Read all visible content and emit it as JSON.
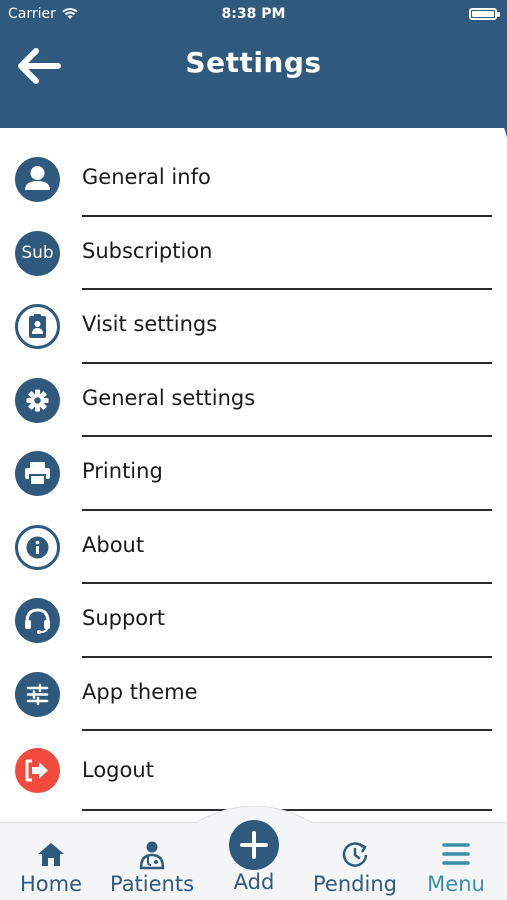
{
  "status_bar": {
    "carrier": "Carrier",
    "time": "8:38 PM"
  },
  "header": {
    "title": "Settings",
    "color": "#2f5a7e"
  },
  "menu": {
    "items": [
      {
        "label": "General info",
        "icon": "person-icon"
      },
      {
        "label": "Subscription",
        "icon": "sub-icon",
        "icon_text": "Sub"
      },
      {
        "label": "Visit settings",
        "icon": "clipboard-icon"
      },
      {
        "label": "General settings",
        "icon": "gear-icon"
      },
      {
        "label": "Printing",
        "icon": "printer-icon"
      },
      {
        "label": "About",
        "icon": "info-icon"
      },
      {
        "label": "Support",
        "icon": "headset-icon"
      },
      {
        "label": "App theme",
        "icon": "sliders-icon"
      },
      {
        "label": "Logout",
        "icon": "logout-icon",
        "accent": "#f24a3d"
      }
    ]
  },
  "bottom_nav": {
    "items": [
      {
        "label": "Home",
        "icon": "home-icon"
      },
      {
        "label": "Patients",
        "icon": "doctor-icon"
      },
      {
        "label": "Add",
        "icon": "plus-icon"
      },
      {
        "label": "Pending",
        "icon": "clock-refresh-icon"
      },
      {
        "label": "Menu",
        "icon": "hamburger-icon",
        "active": true
      }
    ],
    "active_color": "#3b8fa6"
  }
}
